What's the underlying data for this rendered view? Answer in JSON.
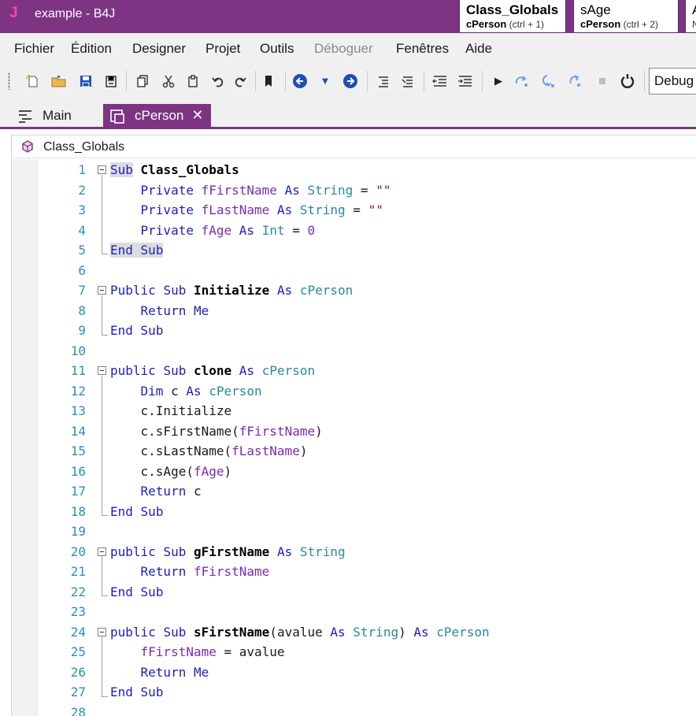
{
  "window": {
    "logo": "J",
    "title": "example - B4J",
    "quick_tabs": [
      {
        "name": "Class_Globals",
        "module": "cPerson",
        "shortcut": "(ctrl + 1)"
      },
      {
        "name": "sAge",
        "module": "cPerson",
        "shortcut": "(ctrl + 2)"
      },
      {
        "name": "A",
        "module": "N",
        "shortcut": ""
      }
    ]
  },
  "menu": [
    "Fichier",
    "Édition",
    "Designer",
    "Projet",
    "Outils",
    "Déboguer",
    "Fenêtres",
    "Aide"
  ],
  "toolbar": {
    "config_value": "Debug"
  },
  "tabs": [
    {
      "label": "Main"
    },
    {
      "label": "cPerson",
      "close": "✕"
    }
  ],
  "breadcrumb": "Class_Globals",
  "code_lines": [
    {
      "n": "1",
      "t": "Sub Class_Globals"
    },
    {
      "n": "2",
      "t": "    Private fFirstName As String = \"\""
    },
    {
      "n": "3",
      "t": "    Private fLastName As String = \"\""
    },
    {
      "n": "4",
      "t": "    Private fAge As Int = 0"
    },
    {
      "n": "5",
      "t": "End Sub"
    },
    {
      "n": "6",
      "t": ""
    },
    {
      "n": "7",
      "t": "Public Sub Initialize As cPerson"
    },
    {
      "n": "8",
      "t": "    Return Me"
    },
    {
      "n": "9",
      "t": "End Sub"
    },
    {
      "n": "10",
      "t": ""
    },
    {
      "n": "11",
      "t": "public Sub clone As cPerson"
    },
    {
      "n": "12",
      "t": "    Dim c As cPerson"
    },
    {
      "n": "13",
      "t": "    c.Initialize"
    },
    {
      "n": "14",
      "t": "    c.sFirstName(fFirstName)"
    },
    {
      "n": "15",
      "t": "    c.sLastName(fLastName)"
    },
    {
      "n": "16",
      "t": "    c.sAge(fAge)"
    },
    {
      "n": "17",
      "t": "    Return c"
    },
    {
      "n": "18",
      "t": "End Sub"
    },
    {
      "n": "19",
      "t": ""
    },
    {
      "n": "20",
      "t": "public Sub gFirstName As String"
    },
    {
      "n": "21",
      "t": "    Return fFirstName"
    },
    {
      "n": "22",
      "t": "End Sub"
    },
    {
      "n": "23",
      "t": ""
    },
    {
      "n": "24",
      "t": "public Sub sFirstName(avalue As String) As cPerson"
    },
    {
      "n": "25",
      "t": "    fFirstName = avalue"
    },
    {
      "n": "26",
      "t": "    Return Me"
    },
    {
      "n": "27",
      "t": "End Sub"
    },
    {
      "n": "28",
      "t": ""
    }
  ],
  "colors": {
    "accent": "#7d3483",
    "keyword": "#1c1cc7",
    "type": "#2a8a9a",
    "string": "#a31515",
    "identifier": "#7a2bb5",
    "line_number": "#2b91af"
  }
}
